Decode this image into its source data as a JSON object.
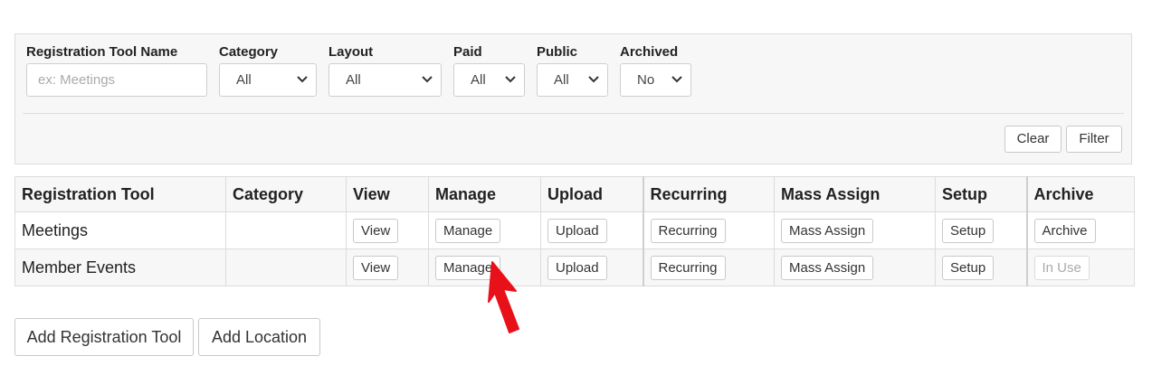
{
  "filters": {
    "name": {
      "label": "Registration Tool Name",
      "placeholder": "ex: Meetings"
    },
    "category": {
      "label": "Category",
      "value": "All"
    },
    "layout": {
      "label": "Layout",
      "value": "All"
    },
    "paid": {
      "label": "Paid",
      "value": "All"
    },
    "public": {
      "label": "Public",
      "value": "All"
    },
    "archived": {
      "label": "Archived",
      "value": "No"
    },
    "clear_label": "Clear",
    "filter_label": "Filter"
  },
  "table": {
    "headers": {
      "tool": "Registration Tool",
      "category": "Category",
      "view": "View",
      "manage": "Manage",
      "upload": "Upload",
      "recurring": "Recurring",
      "mass_assign": "Mass Assign",
      "setup": "Setup",
      "archive": "Archive"
    },
    "rows": [
      {
        "name": "Meetings",
        "category": "",
        "view": "View",
        "manage": "Manage",
        "upload": "Upload",
        "recurring": "Recurring",
        "mass_assign": "Mass Assign",
        "setup": "Setup",
        "archive": "Archive"
      },
      {
        "name": "Member Events",
        "category": "",
        "view": "View",
        "manage": "Manage",
        "upload": "Upload",
        "recurring": "Recurring",
        "mass_assign": "Mass Assign",
        "setup": "Setup",
        "archive": "In Use"
      }
    ]
  },
  "actions": {
    "add_tool": "Add Registration Tool",
    "add_location": "Add Location"
  },
  "colors": {
    "pointer_arrow": "#e8111a",
    "panel_background": "#f7f7f8"
  },
  "icons": {
    "select_chevron": "chevron-down-icon",
    "pointer": "red-arrow-pointer-icon"
  }
}
